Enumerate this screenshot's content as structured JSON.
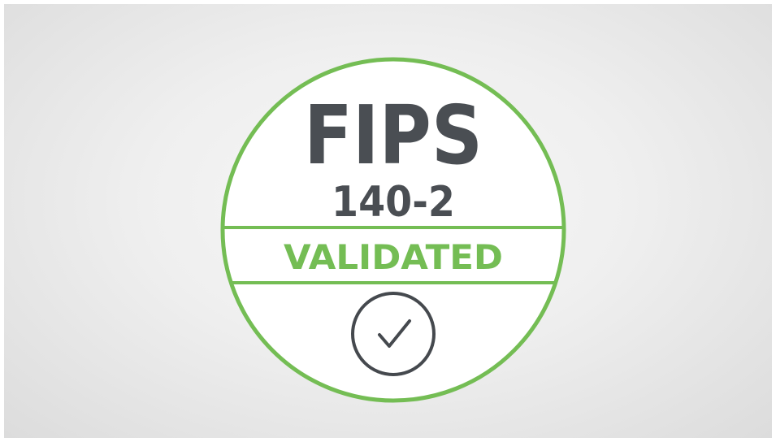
{
  "badge": {
    "title": "FIPS",
    "subtitle": "140-2",
    "status": "VALIDATED",
    "icon": "checkmark-circle-icon"
  },
  "colors": {
    "ring": "#74bd54",
    "dark_text": "#4a4e53",
    "status_text": "#74bd54",
    "badge_fill": "#ffffff",
    "check": "#45494e"
  }
}
